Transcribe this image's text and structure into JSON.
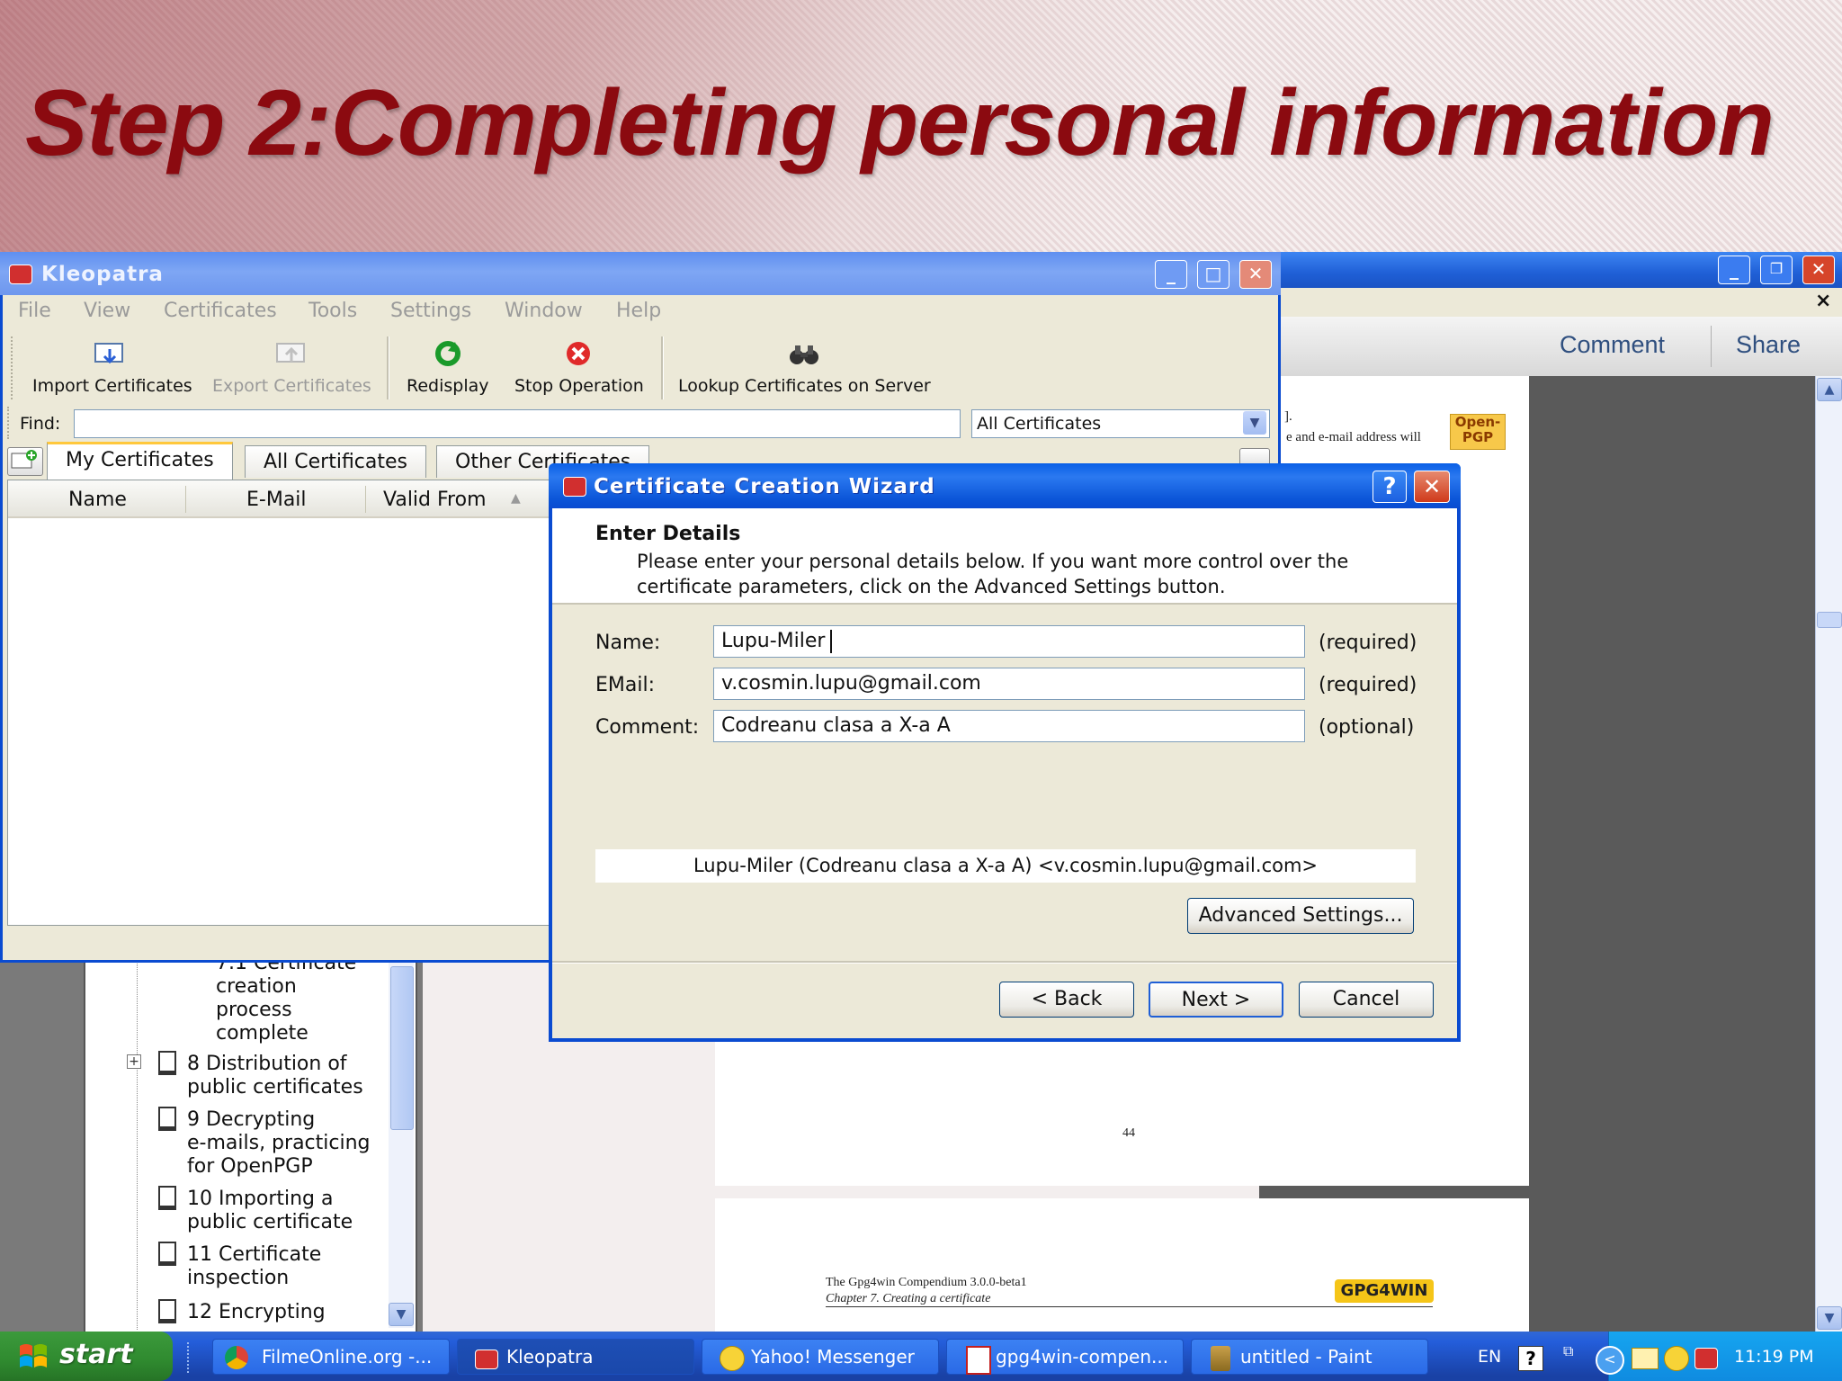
{
  "slide": {
    "title": "Step 2:Completing personal information"
  },
  "pdf_viewer": {
    "toolbar": {
      "comment": "Comment",
      "share": "Share"
    },
    "close_glyph": "×",
    "snippet_line1": "].",
    "snippet_line2": "e and e-mail address will",
    "openpgp_badge": "Open-\nPGP",
    "page_number": "44",
    "footer_line1": "The Gpg4win Compendium 3.0.0-beta1",
    "footer_line2": "Chapter 7.  Creating a certificate",
    "footer_logo": "GPG4WIN"
  },
  "bookmarks": {
    "items": [
      {
        "text": "7.1 Certificate\ncreation\nprocess\ncomplete"
      },
      {
        "text": "8 Distribution of\npublic certificates"
      },
      {
        "text": "9 Decrypting\ne-mails, practicing\nfor OpenPGP"
      },
      {
        "text": "10 Importing a\npublic certificate"
      },
      {
        "text": "11 Certificate\ninspection"
      },
      {
        "text": "12 Encrypting"
      }
    ]
  },
  "kleopatra": {
    "title": "Kleopatra",
    "menu": [
      "File",
      "View",
      "Certificates",
      "Tools",
      "Settings",
      "Window",
      "Help"
    ],
    "toolbar": {
      "import": "Import Certificates",
      "export": "Export Certificates",
      "redisplay": "Redisplay",
      "stop": "Stop Operation",
      "lookup": "Lookup Certificates on Server"
    },
    "find_label": "Find:",
    "find_value": "",
    "filter_selected": "All Certificates",
    "tabs": [
      "My Certificates",
      "All Certificates",
      "Other Certificates"
    ],
    "columns": [
      "Name",
      "E-Mail",
      "Valid From"
    ]
  },
  "wizard": {
    "title": "Certificate Creation Wizard",
    "heading": "Enter Details",
    "description": "Please enter your personal details below. If you want more control over the certificate parameters, click on the Advanced Settings button.",
    "fields": {
      "name": {
        "label": "Name:",
        "value": "Lupu-Miler",
        "hint": "(required)"
      },
      "email": {
        "label": "EMail:",
        "value": "v.cosmin.lupu@gmail.com",
        "hint": "(required)"
      },
      "comment": {
        "label": "Comment:",
        "value": "Codreanu clasa a X-a A",
        "hint": "(optional)"
      }
    },
    "preview": "Lupu-Miler (Codreanu clasa a X-a A) <v.cosmin.lupu@gmail.com>",
    "advanced_button": "Advanced Settings...",
    "back_button": "< Back",
    "next_button": "Next >",
    "cancel_button": "Cancel"
  },
  "taskbar": {
    "start": "start",
    "tasks": [
      "FilmeOnline.org -...",
      "Kleopatra",
      "Yahoo! Messenger",
      "gpg4win-compen...",
      "untitled - Paint"
    ],
    "language": "EN",
    "clock": "11:19 PM"
  },
  "colors": {
    "title_red": "#8b0a10",
    "xp_blue": "#0a4bd1",
    "start_green": "#2f8a2f"
  }
}
